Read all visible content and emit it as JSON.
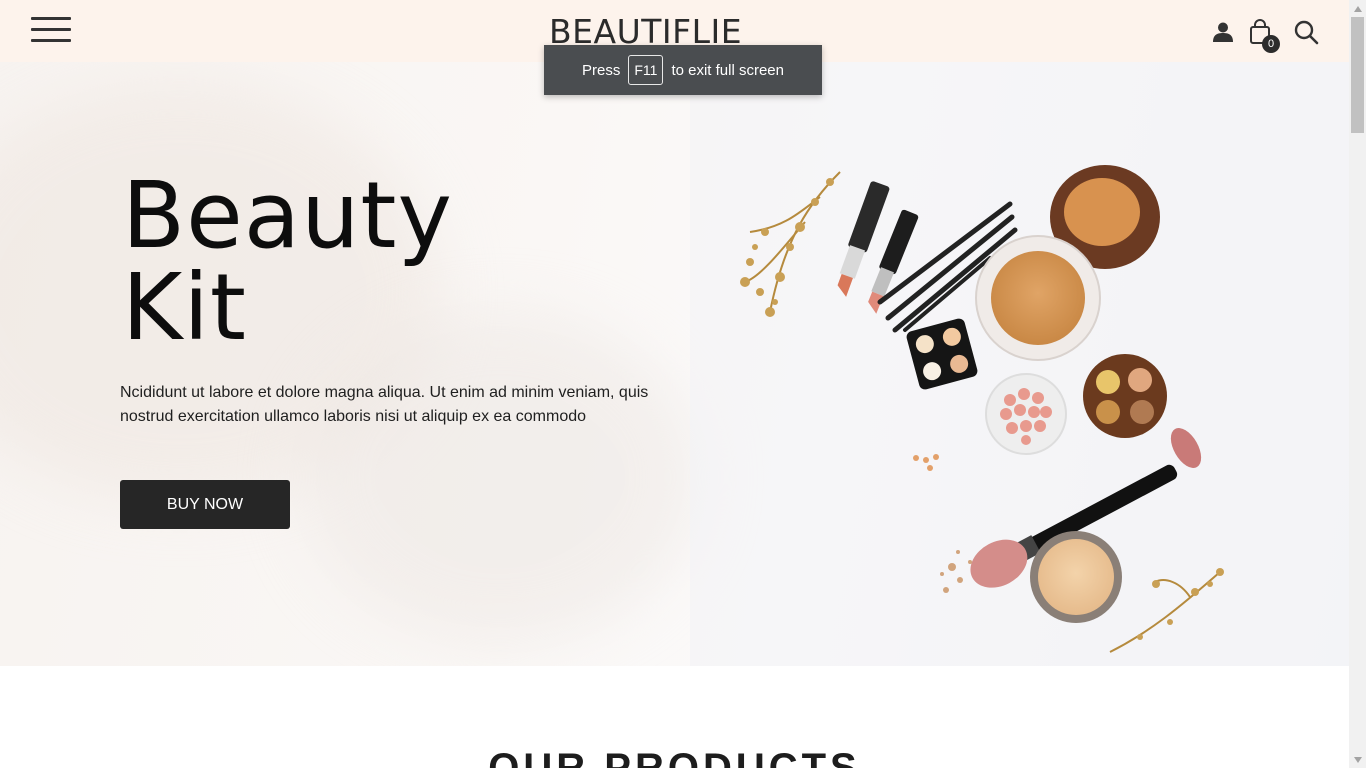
{
  "header": {
    "brand": "BEAUTIFLIE",
    "cart_count": "0",
    "icons": [
      "menu-icon",
      "user-icon",
      "cart-icon",
      "search-icon"
    ]
  },
  "fullscreen_notice": {
    "prefix": "Press",
    "key": "F11",
    "suffix": "to exit full screen"
  },
  "hero": {
    "title_line1": "Beauty",
    "title_line2": "Kit",
    "description": "Ncididunt ut labore et dolore magna aliqua. Ut enim ad minim veniam, quis nostrud exercitation ullamco laboris nisi ut aliquip ex ea commodo",
    "button_label": "BUY NOW"
  },
  "products": {
    "heading": "OUR PRODUCTS"
  },
  "colors": {
    "header_bg": "#fdf3ec",
    "button_bg": "#262626",
    "toast_bg": "#4a4d50"
  }
}
